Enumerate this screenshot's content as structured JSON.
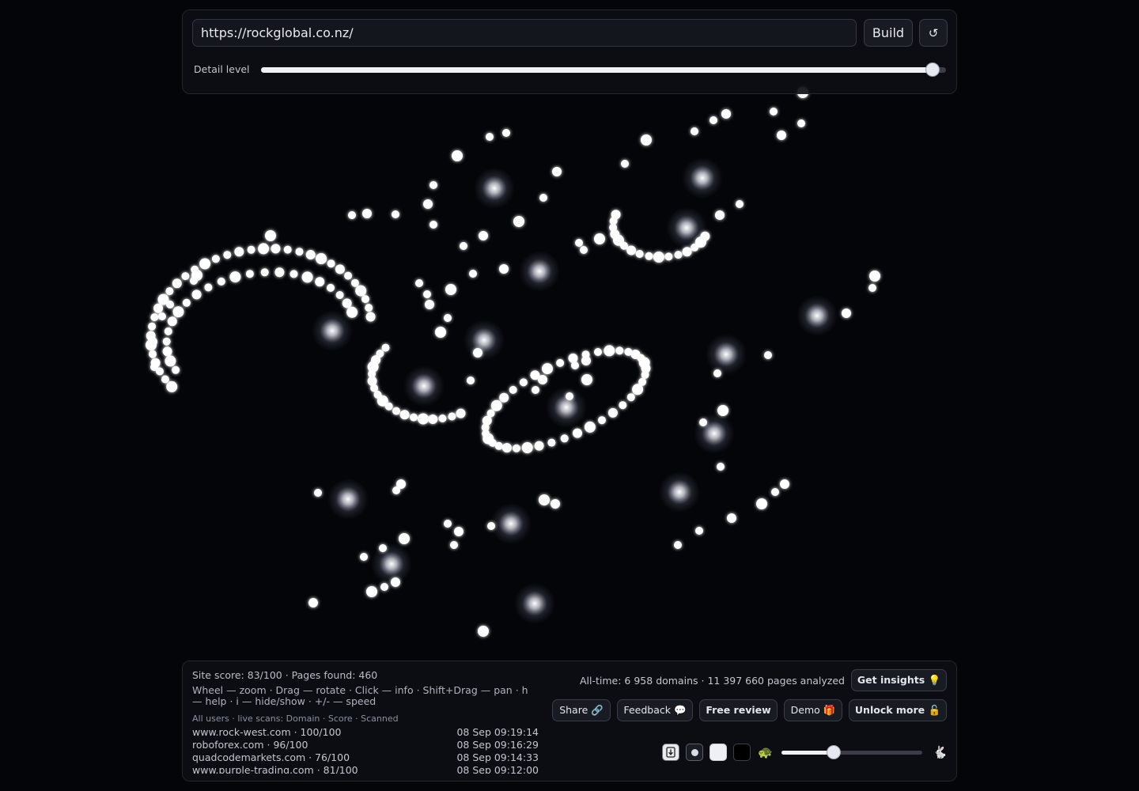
{
  "toolbar": {
    "url_value": "https://rockglobal.co.nz/",
    "build_label": "Build",
    "reset_label": "↺",
    "detail_label": "Detail level",
    "detail_level": 0.98
  },
  "stats": {
    "score_line": "Site score: 83/100 · Pages found: 460",
    "help_line": "Wheel — zoom · Drag — rotate · Click — info · Shift+Drag — pan · h — help · i — hide/show · +/- — speed",
    "live_header": "All users · live scans: Domain · Score · Scanned",
    "alltime": "All-time: 6 958 domains · 11 397 660 pages analyzed"
  },
  "scans": [
    {
      "domain": "www.rock-west.com · 100/100",
      "time": "08 Sep 09:19:14"
    },
    {
      "domain": "roboforex.com · 96/100",
      "time": "08 Sep 09:16:29"
    },
    {
      "domain": "quadcodemarkets.com · 76/100",
      "time": "08 Sep 09:14:33"
    },
    {
      "domain": "www.purple-trading.com · 81/100",
      "time": "08 Sep 09:12:00"
    }
  ],
  "buttons": {
    "insights": "Get insights 💡",
    "share": "Share 🔗",
    "feedback": "Feedback 💬",
    "review": "Free review",
    "demo": "Demo 🎁",
    "unlock": "Unlock more 🔓"
  },
  "controls": {
    "turtle": "🐢",
    "rabbit": "🐇",
    "speed_level": 0.37
  },
  "icons": [
    "download-icon",
    "dot-icon",
    "light-theme-icon",
    "dark-theme-icon",
    "turtle-icon",
    "rabbit-icon",
    "reset-icon"
  ],
  "colors": {
    "background": "#040509",
    "node_glow": "#ffffff",
    "panel": "#0c0e14"
  }
}
